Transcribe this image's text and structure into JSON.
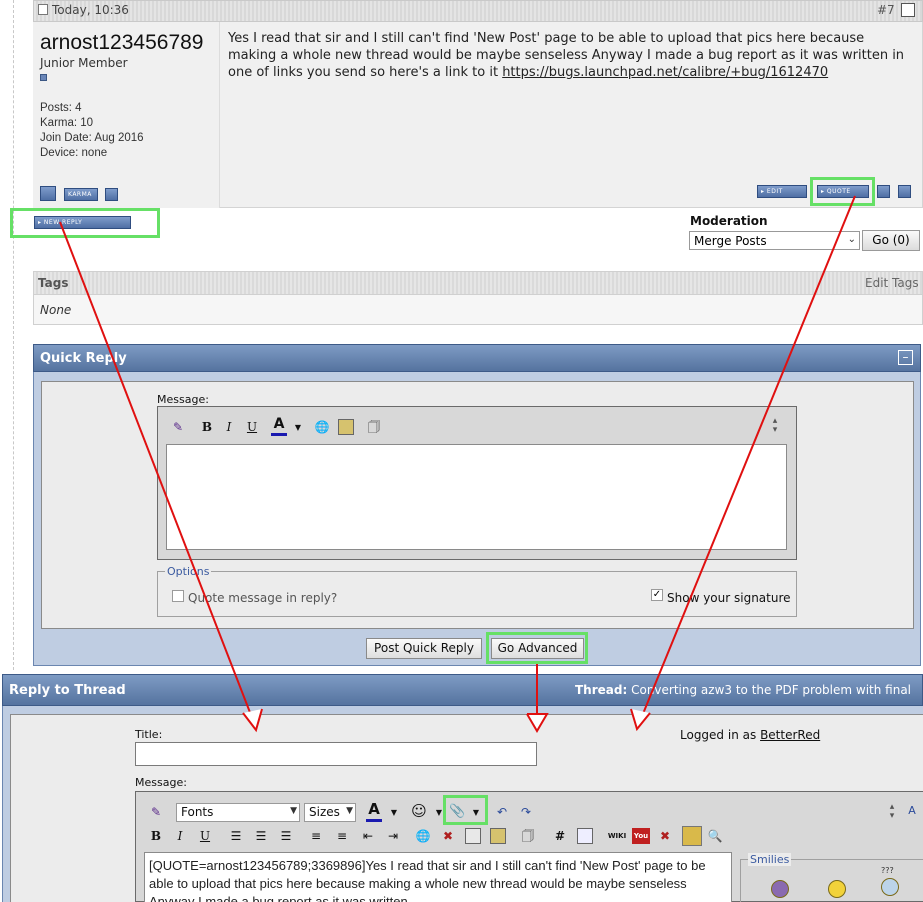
{
  "post": {
    "date": "Today, 10:36",
    "number": "#7",
    "username": "arnost123456789",
    "user_title": "Junior Member",
    "stats": {
      "posts": "Posts: 4",
      "karma": "Karma: 10",
      "join_date": "Join Date: Aug 2016",
      "device": "Device: none"
    },
    "message_text": "Yes I read that sir and I still can't find 'New Post' page to be able to upload that pics here because making a whole new thread would be maybe senseless Anyway I made a bug report as it was written in one of links you send so here's a link to it",
    "message_link": "https://bugs.launchpad.net/calibre/+bug/1612470",
    "buttons": {
      "karma": "Karma",
      "edit": "Edit",
      "quote": "Quote",
      "new_reply": "New Reply"
    }
  },
  "moderation": {
    "label": "Moderation",
    "selected": "Merge Posts",
    "go_label": "Go (0)"
  },
  "tags": {
    "title": "Tags",
    "edit_label": "Edit Tags",
    "value": "None"
  },
  "quick_reply": {
    "title": "Quick Reply",
    "collapse": "–",
    "message_label": "Message:",
    "options_legend": "Options",
    "quote_label": "Quote message in reply?",
    "signature_label": "Show your signature",
    "signature_checked": "✓",
    "post_button": "Post Quick Reply",
    "advanced_button": "Go Advanced",
    "toolbar": {
      "bold": "B",
      "italic": "I",
      "underline": "U",
      "color": "A"
    }
  },
  "reply_thread": {
    "title": "Reply to Thread",
    "thread_label": "Thread:",
    "thread_name": "Converting azw3 to the PDF problem with final",
    "title_label": "Title:",
    "logged_in_prefix": "Logged in as",
    "logged_in_user": "BetterRed",
    "message_label": "Message:",
    "fonts": "Fonts",
    "sizes": "Sizes",
    "toolbar": {
      "bold": "B",
      "italic": "I",
      "underline": "U",
      "color": "A",
      "hash": "#",
      "wiki": "WIKI",
      "youtube": "You"
    },
    "quote_text": "[QUOTE=arnost123456789;3369896]Yes I read that sir and I still can't find 'New Post' page to be able to upload that pics here because making a whole new thread would be maybe senseless Anyway I made a bug report as it was written",
    "smilies_legend": "Smilies",
    "smiley_question": "???"
  },
  "colors": {
    "header_blue": "#55739f",
    "highlight_green": "#66e066",
    "arrow_red": "#e01010"
  }
}
